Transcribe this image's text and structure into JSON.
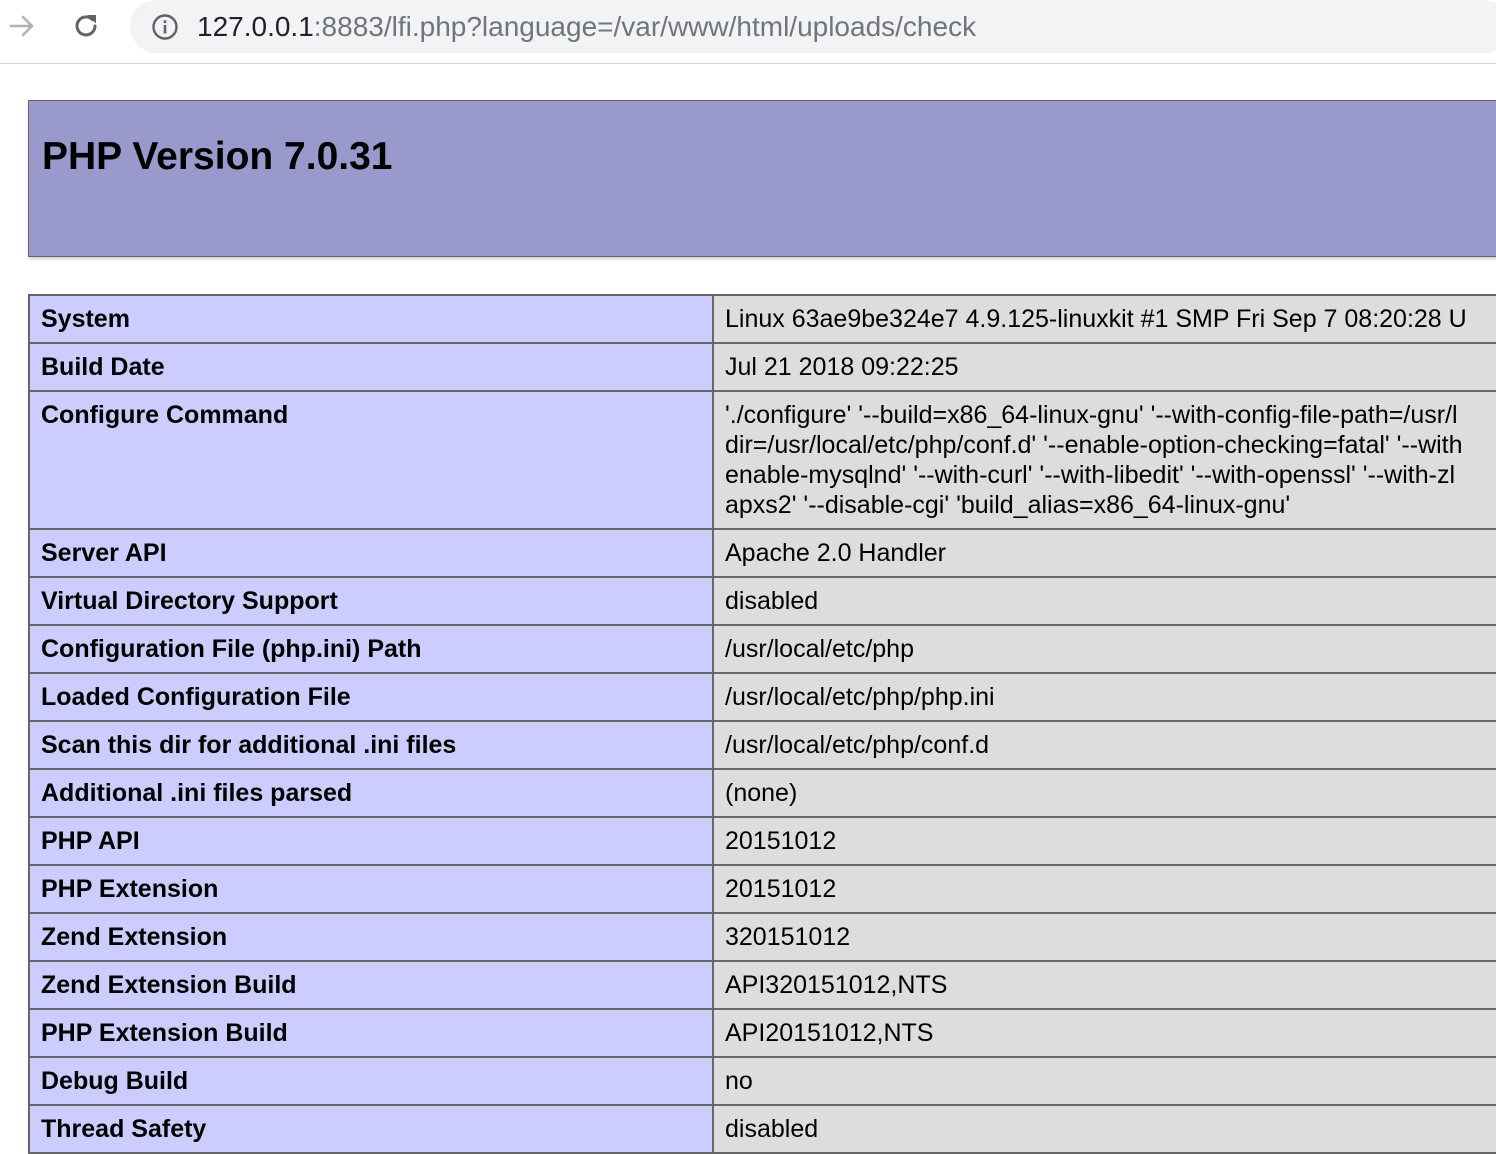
{
  "browser": {
    "url_host": "127.0.0.1",
    "url_rest": ":8883/lfi.php?language=/var/www/html/uploads/check",
    "icons": {
      "forward": "arrow-right-icon",
      "reload": "reload-icon",
      "info": "info-circle-icon"
    }
  },
  "page": {
    "title": "PHP Version 7.0.31",
    "colors": {
      "header_bg": "#9999cc",
      "key_bg": "#ccccff",
      "value_bg": "#dddddd",
      "border": "#666666"
    }
  },
  "rows": [
    {
      "key": "System",
      "value": "Linux 63ae9be324e7 4.9.125-linuxkit #1 SMP Fri Sep 7 08:20:28 U"
    },
    {
      "key": "Build Date",
      "value": "Jul 21 2018 09:22:25"
    },
    {
      "key": "Configure Command",
      "lines": [
        "'./configure' '--build=x86_64-linux-gnu' '--with-config-file-path=/usr/l",
        "dir=/usr/local/etc/php/conf.d' '--enable-option-checking=fatal' '--with",
        "enable-mysqlnd' '--with-curl' '--with-libedit' '--with-openssl' '--with-zl",
        "apxs2' '--disable-cgi' 'build_alias=x86_64-linux-gnu'"
      ]
    },
    {
      "key": "Server API",
      "value": "Apache 2.0 Handler"
    },
    {
      "key": "Virtual Directory Support",
      "value": "disabled"
    },
    {
      "key": "Configuration File (php.ini) Path",
      "value": "/usr/local/etc/php"
    },
    {
      "key": "Loaded Configuration File",
      "value": "/usr/local/etc/php/php.ini"
    },
    {
      "key": "Scan this dir for additional .ini files",
      "value": "/usr/local/etc/php/conf.d"
    },
    {
      "key": "Additional .ini files parsed",
      "value": "(none)"
    },
    {
      "key": "PHP API",
      "value": "20151012"
    },
    {
      "key": "PHP Extension",
      "value": "20151012"
    },
    {
      "key": "Zend Extension",
      "value": "320151012"
    },
    {
      "key": "Zend Extension Build",
      "value": "API320151012,NTS"
    },
    {
      "key": "PHP Extension Build",
      "value": "API20151012,NTS"
    },
    {
      "key": "Debug Build",
      "value": "no"
    },
    {
      "key": "Thread Safety",
      "value": "disabled"
    }
  ]
}
